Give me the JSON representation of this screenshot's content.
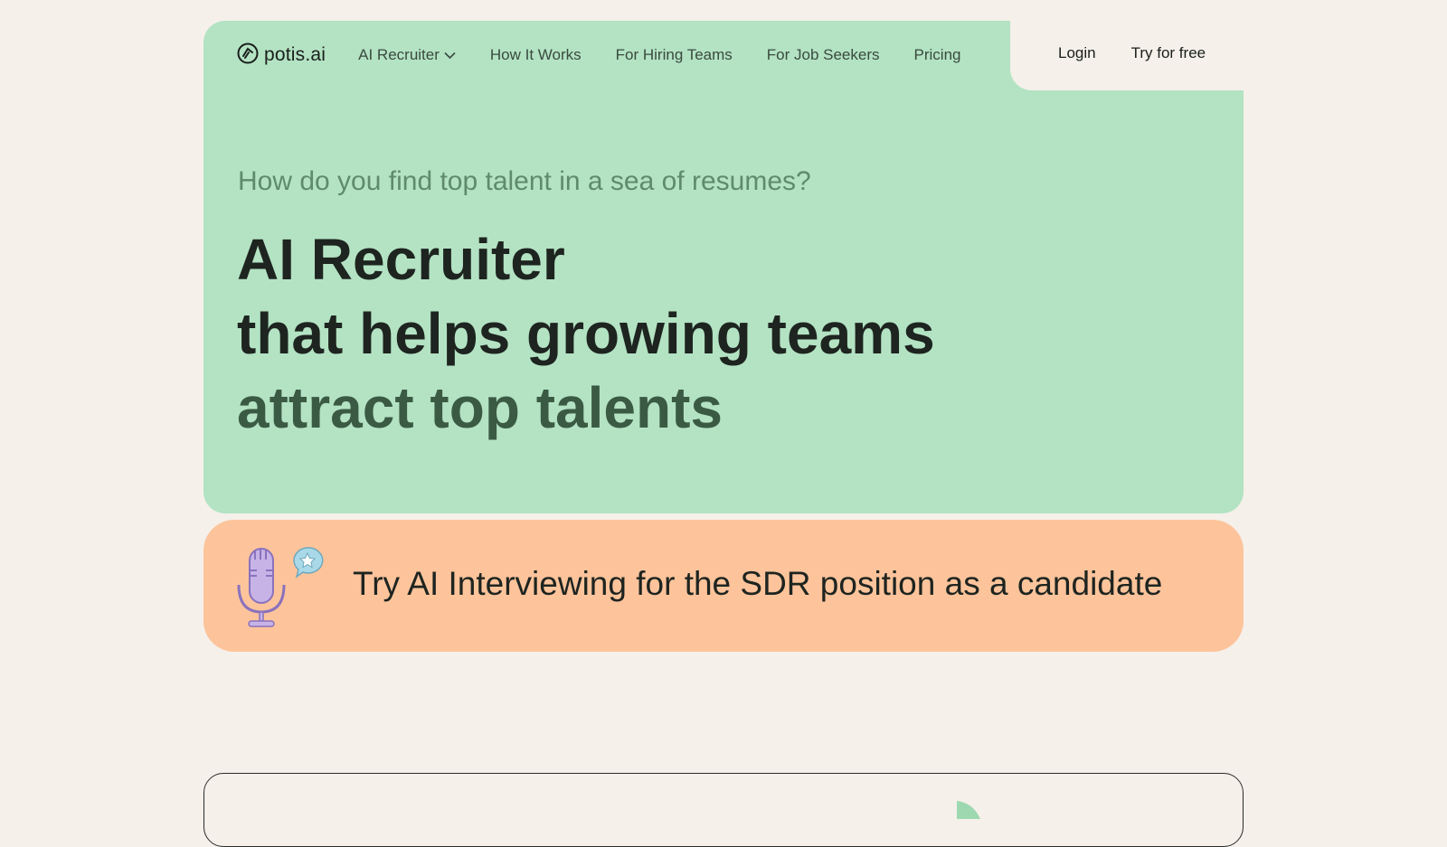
{
  "brand": {
    "name": "potis.ai",
    "logo_icon": "potis-logo-icon"
  },
  "nav": {
    "items": [
      {
        "label": "AI Recruiter",
        "has_dropdown": true
      },
      {
        "label": "How It Works"
      },
      {
        "label": "For Hiring Teams"
      },
      {
        "label": "For Job Seekers"
      },
      {
        "label": "Pricing"
      }
    ],
    "login": "Login",
    "try_free": "Try for free"
  },
  "hero": {
    "eyebrow": "How do you find top talent in a sea of resumes?",
    "line1": "AI Recruiter",
    "line2": "that helps growing teams",
    "line3": "attract top talents"
  },
  "cta": {
    "text": "Try AI Interviewing for the SDR position as a candidate",
    "icon": "microphone-icon",
    "badge_icon": "star-speech-bubble-icon"
  },
  "colors": {
    "page_bg": "#f5f0ea",
    "hero_bg": "#b3e3c3",
    "cta_bg": "#fdc49b",
    "accent_text": "#3b5a44",
    "mic_purple": "#c7b3e6",
    "bubble_blue": "#a9d9e8"
  }
}
